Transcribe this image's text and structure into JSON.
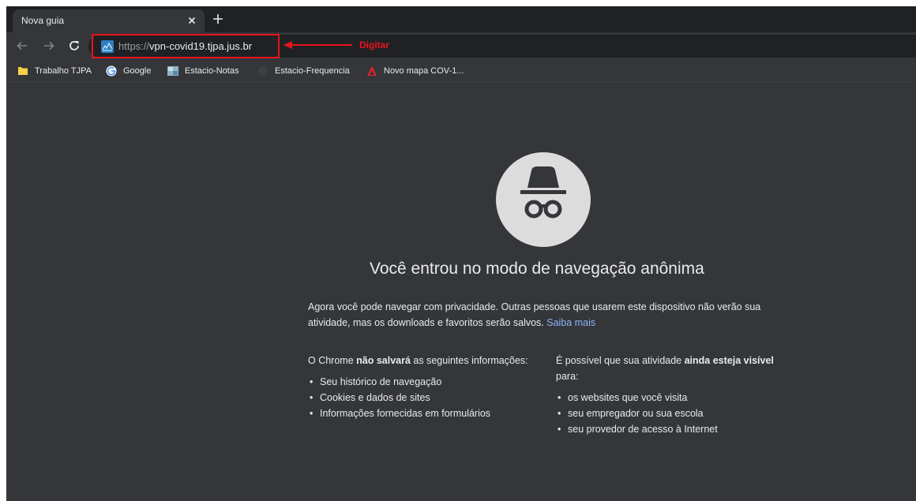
{
  "tab": {
    "title": "Nova guia"
  },
  "toolbar": {
    "url_scheme": "https://",
    "url_host": "vpn-covid19.tjpa.jus.br",
    "annotation_label": "Digitar",
    "annotation_color": "#e8141c"
  },
  "bookmarks": [
    {
      "label": "Trabalho TJPA",
      "icon": "folder-icon"
    },
    {
      "label": "Google",
      "icon": "google-icon"
    },
    {
      "label": "Estacio-Notas",
      "icon": "site-thumbnail-icon"
    },
    {
      "label": "Estacio-Frequencia",
      "icon": "globe-icon"
    },
    {
      "label": "Novo mapa COV-1...",
      "icon": "arcgis-icon"
    }
  ],
  "incognito": {
    "headline": "Você entrou no modo de navegação anônima",
    "paragraph": "Agora você pode navegar com privacidade. Outras pessoas que usarem este dispositivo não verão sua atividade, mas os downloads e favoritos serão salvos.",
    "learn_more": "Saiba mais",
    "not_saved_heading_pre": "O Chrome ",
    "not_saved_heading_bold": "não salvará",
    "not_saved_heading_post": " as seguintes informações:",
    "not_saved_items": [
      "Seu histórico de navegação",
      "Cookies e dados de sites",
      "Informações fornecidas em formulários"
    ],
    "visible_heading_pre": "É possível que sua atividade ",
    "visible_heading_bold": "ainda esteja visível",
    "visible_heading_post": " para:",
    "visible_items": [
      "os websites que você visita",
      "seu empregador ou sua escola",
      "seu provedor de acesso à Internet"
    ]
  },
  "colors": {
    "frame": "#202124",
    "toolbar": "#35363a",
    "text": "#e8eaed",
    "link": "#8ab4f8"
  }
}
